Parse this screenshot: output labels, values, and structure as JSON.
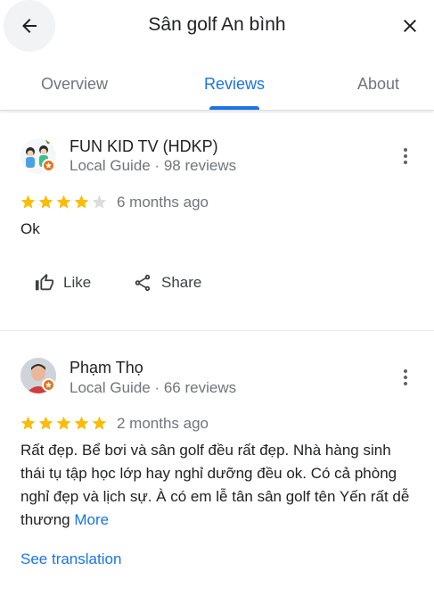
{
  "header": {
    "title": "Sân golf An bình",
    "back_icon": "arrow-back-icon",
    "close_icon": "close-icon"
  },
  "tabs": [
    {
      "label": "Overview",
      "active": false
    },
    {
      "label": "Reviews",
      "active": true
    },
    {
      "label": "About",
      "active": false
    }
  ],
  "colors": {
    "accent": "#1a73e8",
    "star": "#fbbc04",
    "star_empty": "#dadce0",
    "badge": "#e8711a",
    "secondary_text": "#70757a"
  },
  "reviews": [
    {
      "author": "FUN KID TV (HDKP)",
      "meta": "Local Guide · 98 reviews",
      "rating": 4,
      "time": "6 months ago",
      "text": "Ok",
      "actions": {
        "like": "Like",
        "share": "Share"
      }
    },
    {
      "author": "Phạm Thọ",
      "meta": "Local Guide · 66 reviews",
      "rating": 5,
      "time": "2 months ago",
      "text": "Rất đẹp. Bể bơi và sân golf đều rất đẹp. Nhà hàng sinh thái tụ tập học lớp hay nghỉ dưỡng đều ok. Có cả phòng nghỉ đẹp và lịch sự. À có em lễ tân sân golf tên Yến rất dễ thương",
      "more_label": "More",
      "translate_label": "See translation"
    }
  ]
}
